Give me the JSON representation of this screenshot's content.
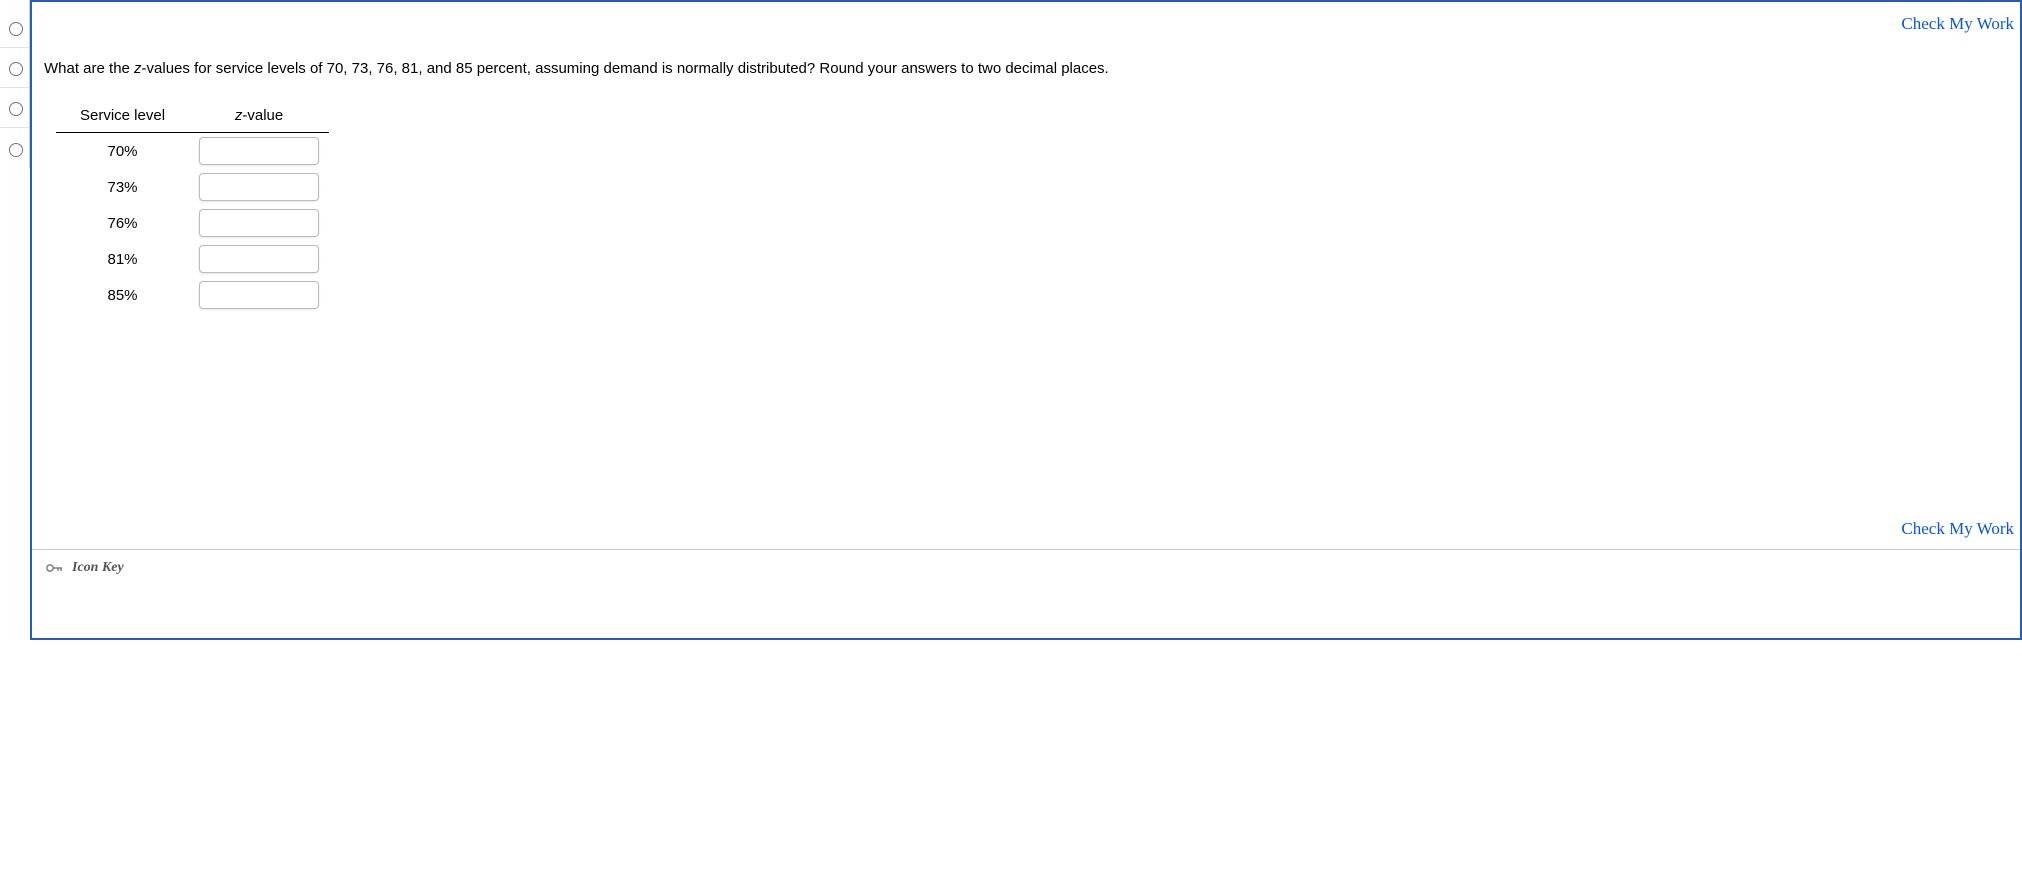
{
  "links": {
    "check_my_work_top": "Check My Work",
    "check_my_work_bottom": "Check My Work"
  },
  "question": {
    "pre": "What are the ",
    "z": "z",
    "post": "-values for service levels of 70, 73, 76, 81, and 85 percent, assuming demand is normally distributed? Round your answers to two decimal places."
  },
  "table": {
    "headers": {
      "col1": "Service level",
      "col2_prefix": "z",
      "col2_suffix": "-value"
    },
    "rows": [
      {
        "level": "70%",
        "value": ""
      },
      {
        "level": "73%",
        "value": ""
      },
      {
        "level": "76%",
        "value": ""
      },
      {
        "level": "81%",
        "value": ""
      },
      {
        "level": "85%",
        "value": ""
      }
    ]
  },
  "footer": {
    "icon_key": "Icon Key"
  }
}
